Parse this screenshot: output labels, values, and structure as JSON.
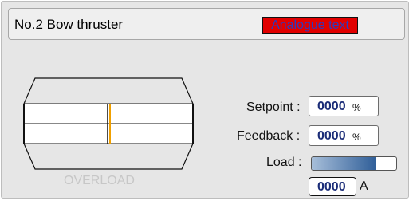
{
  "header": {
    "title": "No.2 Bow thruster",
    "mode_label": "Analogue text"
  },
  "gauge": {
    "overload_label": "OVERLOAD",
    "setpoint_marker_color": "#f0a000"
  },
  "readouts": {
    "setpoint_label": "Setpoint :",
    "setpoint_value": "0000",
    "setpoint_unit": "%",
    "feedback_label": "Feedback :",
    "feedback_value": "0000",
    "feedback_unit": "%",
    "load_label": "Load :",
    "load_fraction": 0.76,
    "load_value": "0000",
    "load_unit": "A"
  },
  "colors": {
    "mode_badge_bg": "#e10000",
    "mode_badge_text": "#2b3bbf",
    "value_text": "#1b2d78",
    "load_bar_fill": "#2f5e98"
  }
}
